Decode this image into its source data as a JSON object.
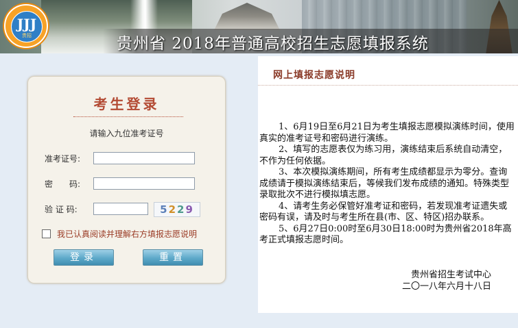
{
  "header": {
    "title": "贵州省 2018年普通高校招生志愿填报系统",
    "logo_glyph": "JJJ",
    "logo_sub": "贵招"
  },
  "login": {
    "title": "考生登录",
    "hint": "请输入九位准考证号",
    "exam_id_label": "准考证号:",
    "password_label": "密　　码:",
    "captcha_label": "验 证 码:",
    "captcha_digits": [
      "5",
      "2",
      "2",
      "9"
    ],
    "agree_text": "我已认真阅读并理解右方填报志愿说明",
    "login_button": "登录",
    "reset_button": "重置"
  },
  "notice": {
    "title": "网上填报志愿说明",
    "items": [
      "1、6月19日至6月21日为考生填报志愿模拟演练时间，使用真实的准考证号和密码进行演练。",
      "2、填写的志愿表仅为练习用，演练结束后系统自动清空，不作为任何依据。",
      "3、本次模拟演练期间，所有考生成绩都显示为零分。查询成绩请于模拟演练结束后，等候我们发布成绩的通知。特殊类型录取批次不进行模拟填志愿。",
      "4、请考生务必保管好准考证和密码，若发现准考证遗失或密码有误，请及时与考生所在县(市、区、特区)招办联系。",
      "5、6月27日0:00时至6月30日18:00时为贵州省2018年高考正式填报志愿时间。"
    ],
    "signature_org": "贵州省招生考试中心",
    "signature_date": "二〇一八年六月十八日"
  }
}
